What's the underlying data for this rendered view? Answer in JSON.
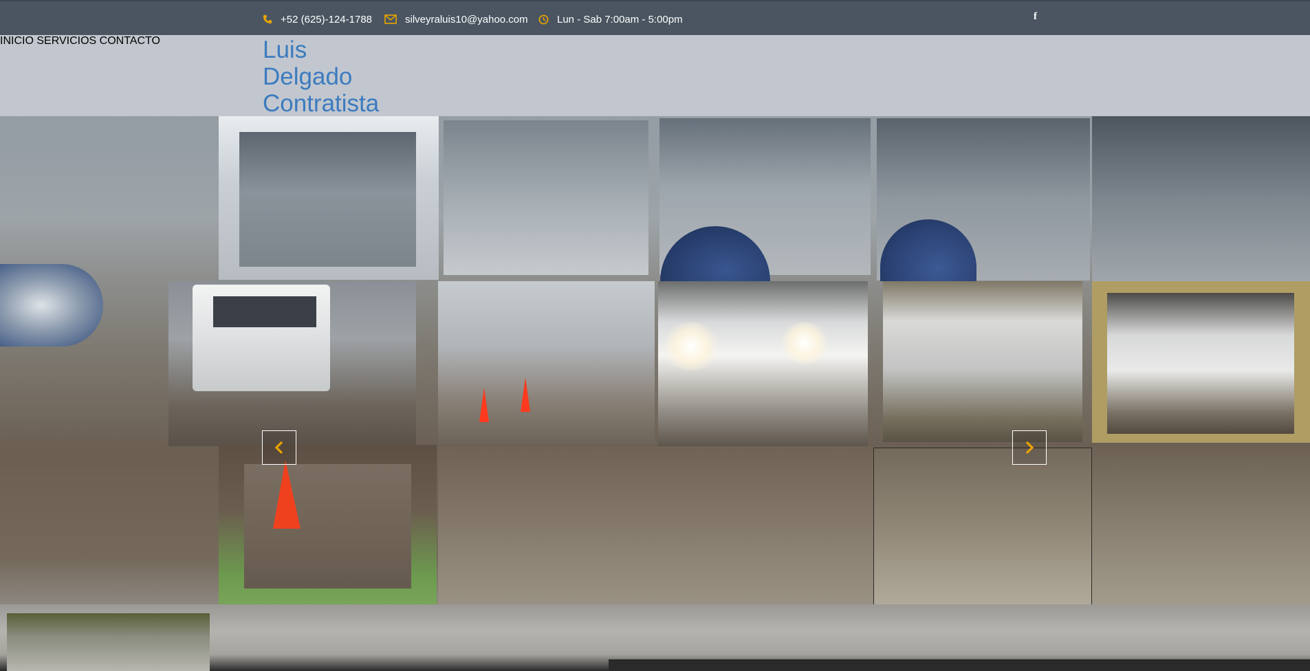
{
  "topbar": {
    "phone": "+52 (625)-124-1788",
    "email": "silveyraluis10@yahoo.com",
    "hours": "Lun - Sab 7:00am - 5:00pm",
    "social_facebook_glyph": "f",
    "icon_color": "#e9a400"
  },
  "header": {
    "logo_line1": "Luis",
    "logo_line2": "Delgado",
    "logo_line3": "Contratista",
    "logo_color": "#3b7bbf"
  },
  "nav": {
    "items": [
      {
        "label": "INICIO"
      },
      {
        "label": "SERVICIOS"
      },
      {
        "label": "CONTACTO"
      }
    ]
  },
  "slider": {
    "prev_icon": "chevron-left-icon",
    "next_icon": "chevron-right-icon",
    "arrow_color": "#e9a400",
    "image_subject": "concrete-mixer-trucks-in-warehouse"
  }
}
